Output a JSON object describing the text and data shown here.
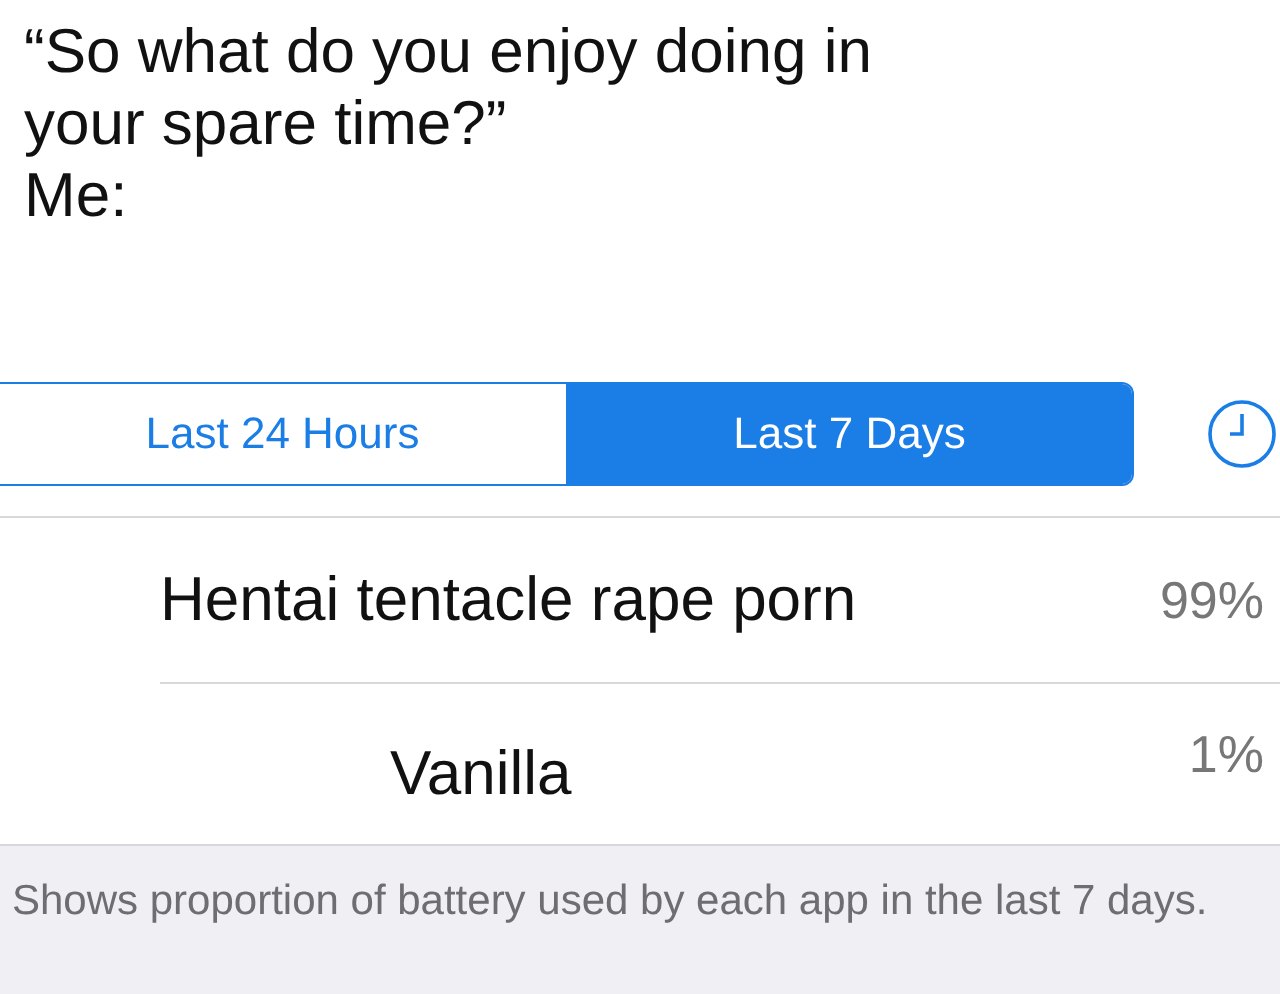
{
  "caption": {
    "lines": [
      "“So what do you enjoy doing in",
      "your spare time?”",
      "Me:"
    ]
  },
  "segments": [
    {
      "label": "Last 24 Hours",
      "selected": false
    },
    {
      "label": "Last 7 Days",
      "selected": true
    }
  ],
  "rows": [
    {
      "name": "Hentai tentacle rape porn",
      "percent": "99%"
    },
    {
      "name": "Vanilla",
      "percent": "1%"
    }
  ],
  "footer": "Shows proportion of battery used by each app in the last 7 days."
}
